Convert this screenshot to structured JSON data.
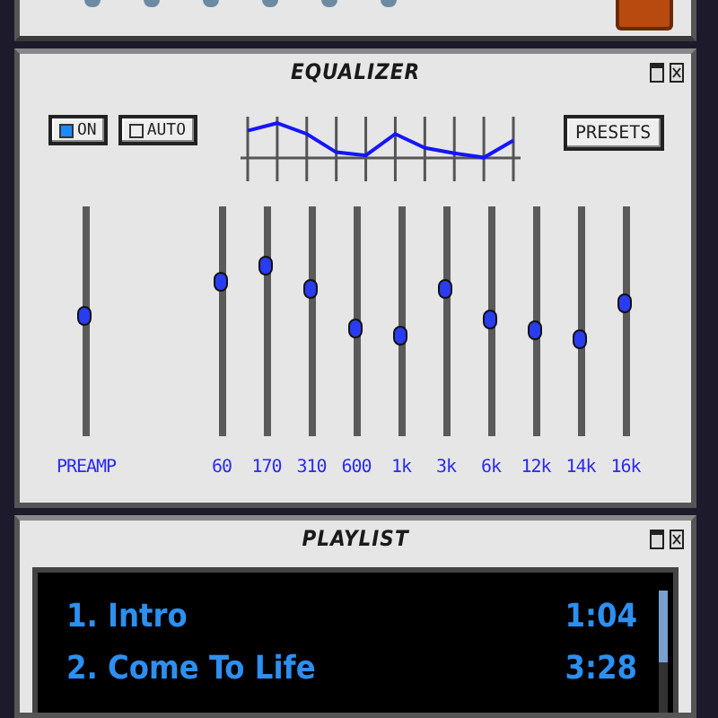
{
  "equalizer": {
    "title": "EQUALIZER",
    "on_button": {
      "label": "ON",
      "checked": true
    },
    "auto_button": {
      "label": "AUTO",
      "checked": false
    },
    "presets_button": {
      "label": "PRESETS"
    },
    "preamp": {
      "label": "PREAMP",
      "level": 0.52
    },
    "bands": [
      {
        "label": "60",
        "level": 0.67
      },
      {
        "label": "170",
        "level": 0.74
      },
      {
        "label": "310",
        "level": 0.64
      },
      {
        "label": "600",
        "level": 0.47
      },
      {
        "label": "1k",
        "level": 0.44
      },
      {
        "label": "3k",
        "level": 0.64
      },
      {
        "label": "6k",
        "level": 0.51
      },
      {
        "label": "12k",
        "level": 0.46
      },
      {
        "label": "14k",
        "level": 0.42
      },
      {
        "label": "16k",
        "level": 0.58
      }
    ]
  },
  "playlist": {
    "title": "PLAYLIST",
    "tracks": [
      {
        "number": "1.",
        "title": "Intro",
        "duration": "1:04"
      },
      {
        "number": "2.",
        "title": "Come To Life",
        "duration": "3:28"
      }
    ]
  }
}
